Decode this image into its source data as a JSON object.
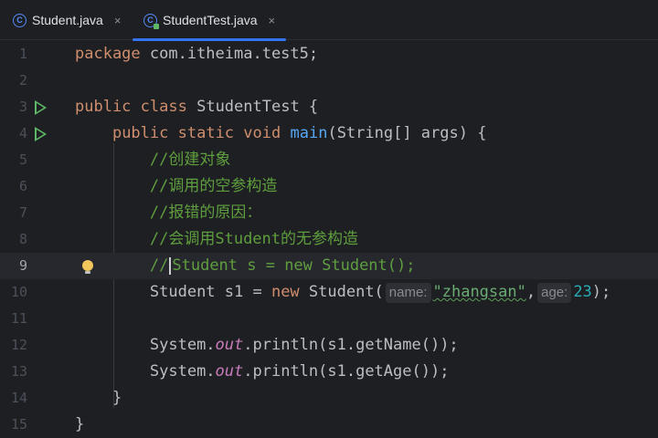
{
  "tabs": [
    {
      "icon_letter": "C",
      "label": "Student.java",
      "close": "×",
      "active": false
    },
    {
      "icon_letter": "C",
      "label": "StudentTest.java",
      "close": "×",
      "active": true
    }
  ],
  "editor": {
    "current_line": 9,
    "line_numbers": [
      "1",
      "2",
      "3",
      "4",
      "5",
      "6",
      "7",
      "8",
      "9",
      "10",
      "11",
      "12",
      "13",
      "14",
      "15"
    ],
    "lines": {
      "l1": {
        "kw": "package",
        "rest": " com.itheima.test5;"
      },
      "l3": {
        "kw1": "public",
        "kw2": "class",
        "rest": " StudentTest {"
      },
      "l4": {
        "kw1": "public",
        "kw2": "static",
        "kw3": "void",
        "fn": "main",
        "rest": "(String[] args) {"
      },
      "l5": {
        "comment": "//创建对象"
      },
      "l6": {
        "comment": "//调用的空参构造"
      },
      "l7": {
        "comment": "//报错的原因："
      },
      "l8": {
        "comment": "//会调用Student的无参构造"
      },
      "l9": {
        "comment_a": "//",
        "comment_b": "Student s = new Student();"
      },
      "l10": {
        "pre": "Student s1 = ",
        "kw": "new",
        "mid": " Student(",
        "hint1": "name:",
        "str": "\"zhangsan\"",
        "comma": ",",
        "hint2": "age:",
        "num": "23",
        "end": ");"
      },
      "l12": {
        "a": "System.",
        "field": "out",
        "b": ".println(s1.getName());"
      },
      "l13": {
        "a": "System.",
        "field": "out",
        "b": ".println(s1.getAge());"
      },
      "l14": {
        "text": "}"
      },
      "l15": {
        "text": "}"
      }
    }
  }
}
